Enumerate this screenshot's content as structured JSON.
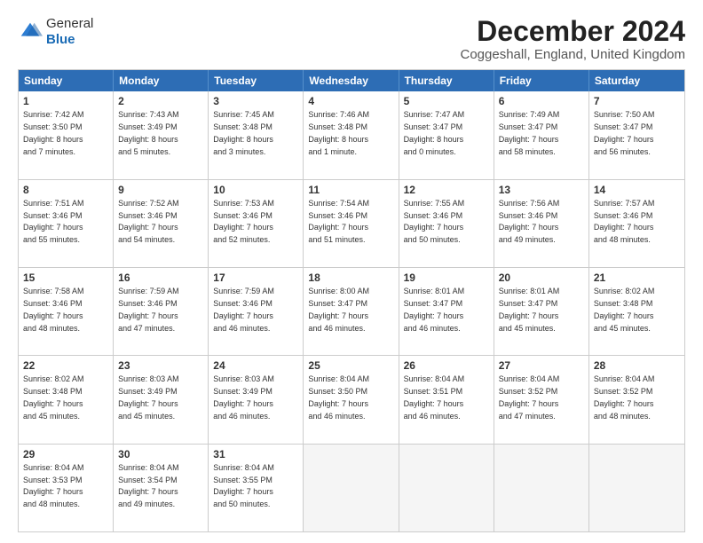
{
  "logo": {
    "general": "General",
    "blue": "Blue"
  },
  "title": "December 2024",
  "subtitle": "Coggeshall, England, United Kingdom",
  "calendar": {
    "headers": [
      "Sunday",
      "Monday",
      "Tuesday",
      "Wednesday",
      "Thursday",
      "Friday",
      "Saturday"
    ],
    "weeks": [
      [
        {
          "day": "1",
          "text": "Sunrise: 7:42 AM\nSunset: 3:50 PM\nDaylight: 8 hours\nand 7 minutes."
        },
        {
          "day": "2",
          "text": "Sunrise: 7:43 AM\nSunset: 3:49 PM\nDaylight: 8 hours\nand 5 minutes."
        },
        {
          "day": "3",
          "text": "Sunrise: 7:45 AM\nSunset: 3:48 PM\nDaylight: 8 hours\nand 3 minutes."
        },
        {
          "day": "4",
          "text": "Sunrise: 7:46 AM\nSunset: 3:48 PM\nDaylight: 8 hours\nand 1 minute."
        },
        {
          "day": "5",
          "text": "Sunrise: 7:47 AM\nSunset: 3:47 PM\nDaylight: 8 hours\nand 0 minutes."
        },
        {
          "day": "6",
          "text": "Sunrise: 7:49 AM\nSunset: 3:47 PM\nDaylight: 7 hours\nand 58 minutes."
        },
        {
          "day": "7",
          "text": "Sunrise: 7:50 AM\nSunset: 3:47 PM\nDaylight: 7 hours\nand 56 minutes."
        }
      ],
      [
        {
          "day": "8",
          "text": "Sunrise: 7:51 AM\nSunset: 3:46 PM\nDaylight: 7 hours\nand 55 minutes."
        },
        {
          "day": "9",
          "text": "Sunrise: 7:52 AM\nSunset: 3:46 PM\nDaylight: 7 hours\nand 54 minutes."
        },
        {
          "day": "10",
          "text": "Sunrise: 7:53 AM\nSunset: 3:46 PM\nDaylight: 7 hours\nand 52 minutes."
        },
        {
          "day": "11",
          "text": "Sunrise: 7:54 AM\nSunset: 3:46 PM\nDaylight: 7 hours\nand 51 minutes."
        },
        {
          "day": "12",
          "text": "Sunrise: 7:55 AM\nSunset: 3:46 PM\nDaylight: 7 hours\nand 50 minutes."
        },
        {
          "day": "13",
          "text": "Sunrise: 7:56 AM\nSunset: 3:46 PM\nDaylight: 7 hours\nand 49 minutes."
        },
        {
          "day": "14",
          "text": "Sunrise: 7:57 AM\nSunset: 3:46 PM\nDaylight: 7 hours\nand 48 minutes."
        }
      ],
      [
        {
          "day": "15",
          "text": "Sunrise: 7:58 AM\nSunset: 3:46 PM\nDaylight: 7 hours\nand 48 minutes."
        },
        {
          "day": "16",
          "text": "Sunrise: 7:59 AM\nSunset: 3:46 PM\nDaylight: 7 hours\nand 47 minutes."
        },
        {
          "day": "17",
          "text": "Sunrise: 7:59 AM\nSunset: 3:46 PM\nDaylight: 7 hours\nand 46 minutes."
        },
        {
          "day": "18",
          "text": "Sunrise: 8:00 AM\nSunset: 3:47 PM\nDaylight: 7 hours\nand 46 minutes."
        },
        {
          "day": "19",
          "text": "Sunrise: 8:01 AM\nSunset: 3:47 PM\nDaylight: 7 hours\nand 46 minutes."
        },
        {
          "day": "20",
          "text": "Sunrise: 8:01 AM\nSunset: 3:47 PM\nDaylight: 7 hours\nand 45 minutes."
        },
        {
          "day": "21",
          "text": "Sunrise: 8:02 AM\nSunset: 3:48 PM\nDaylight: 7 hours\nand 45 minutes."
        }
      ],
      [
        {
          "day": "22",
          "text": "Sunrise: 8:02 AM\nSunset: 3:48 PM\nDaylight: 7 hours\nand 45 minutes."
        },
        {
          "day": "23",
          "text": "Sunrise: 8:03 AM\nSunset: 3:49 PM\nDaylight: 7 hours\nand 45 minutes."
        },
        {
          "day": "24",
          "text": "Sunrise: 8:03 AM\nSunset: 3:49 PM\nDaylight: 7 hours\nand 46 minutes."
        },
        {
          "day": "25",
          "text": "Sunrise: 8:04 AM\nSunset: 3:50 PM\nDaylight: 7 hours\nand 46 minutes."
        },
        {
          "day": "26",
          "text": "Sunrise: 8:04 AM\nSunset: 3:51 PM\nDaylight: 7 hours\nand 46 minutes."
        },
        {
          "day": "27",
          "text": "Sunrise: 8:04 AM\nSunset: 3:52 PM\nDaylight: 7 hours\nand 47 minutes."
        },
        {
          "day": "28",
          "text": "Sunrise: 8:04 AM\nSunset: 3:52 PM\nDaylight: 7 hours\nand 48 minutes."
        }
      ],
      [
        {
          "day": "29",
          "text": "Sunrise: 8:04 AM\nSunset: 3:53 PM\nDaylight: 7 hours\nand 48 minutes."
        },
        {
          "day": "30",
          "text": "Sunrise: 8:04 AM\nSunset: 3:54 PM\nDaylight: 7 hours\nand 49 minutes."
        },
        {
          "day": "31",
          "text": "Sunrise: 8:04 AM\nSunset: 3:55 PM\nDaylight: 7 hours\nand 50 minutes."
        },
        {
          "day": "",
          "text": ""
        },
        {
          "day": "",
          "text": ""
        },
        {
          "day": "",
          "text": ""
        },
        {
          "day": "",
          "text": ""
        }
      ]
    ]
  }
}
